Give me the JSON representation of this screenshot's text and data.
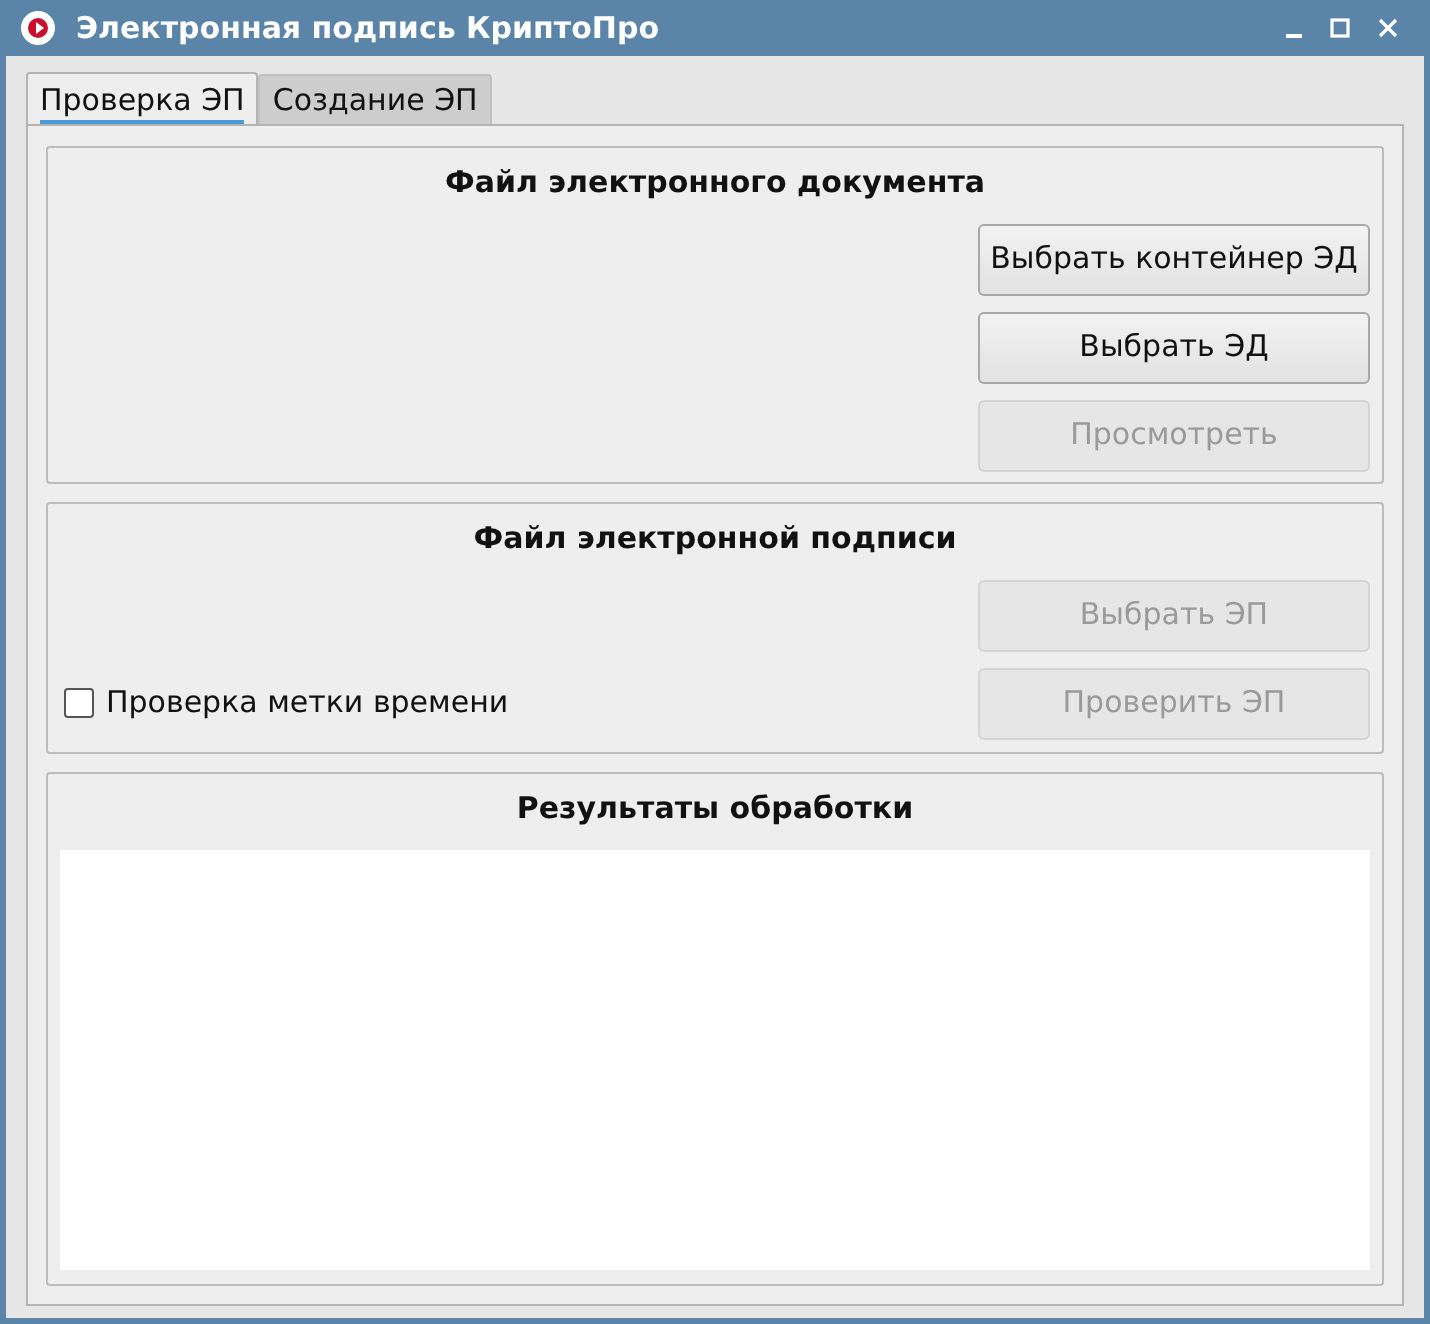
{
  "window": {
    "title": "Электронная подпись КриптоПро"
  },
  "tabs": [
    {
      "label": "Проверка ЭП",
      "selected": true
    },
    {
      "label": "Создание ЭП",
      "selected": false
    }
  ],
  "document_group": {
    "title": "Файл электронного документа",
    "buttons": [
      {
        "label": "Выбрать контейнер ЭД",
        "disabled": false
      },
      {
        "label": "Выбрать ЭД",
        "disabled": false
      },
      {
        "label": "Просмотреть",
        "disabled": true
      }
    ]
  },
  "signature_group": {
    "title": "Файл электронной подписи",
    "checkbox": {
      "label": "Проверка метки времени",
      "checked": false
    },
    "buttons": [
      {
        "label": "Выбрать ЭП",
        "disabled": true
      },
      {
        "label": "Проверить ЭП",
        "disabled": true
      }
    ]
  },
  "results_group": {
    "title": "Результаты обработки"
  }
}
